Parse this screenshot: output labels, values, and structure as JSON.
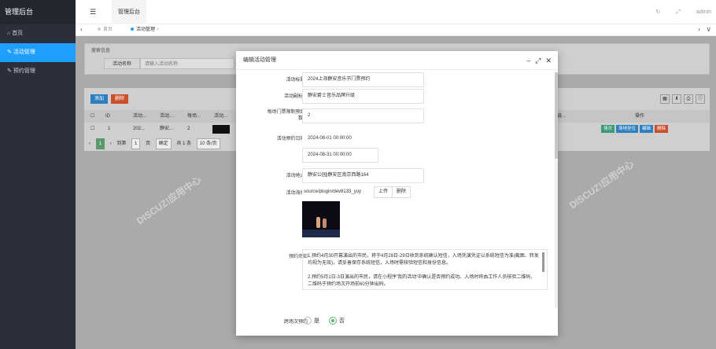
{
  "sidebar": {
    "brand": "管理后台",
    "items": [
      {
        "icon": "home-icon",
        "glyph": "⌂",
        "label": "首页"
      },
      {
        "icon": "edit-icon",
        "glyph": "✎",
        "label": "活动管理"
      },
      {
        "icon": "edit-icon",
        "glyph": "✎",
        "label": "预约管理"
      }
    ]
  },
  "topbar": {
    "title": "管理后台",
    "user": "admin"
  },
  "tabs": [
    {
      "label": "首页"
    },
    {
      "label": "活动管理"
    }
  ],
  "search": {
    "legend": "搜索信息",
    "label": "活动名称",
    "placeholder": "请输入活动名称"
  },
  "table": {
    "add_label": "添加",
    "delete_label": "删除",
    "headers": [
      "ID",
      "活动...",
      "活动...",
      "每场...",
      "活动...",
      "链...",
      "操作"
    ],
    "row": {
      "id": "1",
      "c1": "202...",
      "c2": "静安...",
      "c3": "2"
    },
    "row_actions": [
      "场次",
      "场地坐位",
      "编辑",
      "删除"
    ],
    "pager": {
      "to_label": "到第",
      "page": "1",
      "page_suffix": "页",
      "go_label": "确定",
      "total": "共 1 条",
      "per_page": "10 条/页"
    }
  },
  "modal": {
    "title": "编辑活动管理",
    "fields": {
      "title_label": "活动标题",
      "title_value": "2024上海静安音乐节门票预约",
      "subtitle_label": "活动副标题",
      "subtitle_value": "静安爵士音乐品牌升级",
      "limit_label_1": "每场门票限制预约",
      "limit_label_2": "数量",
      "limit_value": "2",
      "date_label": "活动预约日期",
      "date_start": "2024-08-01 00:00:00",
      "date_end": "2024-08-31 00:00:00",
      "place_label": "活动地点",
      "place_value": "静安公园|静安区南京西路164",
      "poster_label": "活动海报",
      "poster_value": "source/plugin/dev8133_yuy",
      "upload_label": "上传",
      "remove_label": "删除",
      "notice_label": "预约须知",
      "notice_p1": "1.预约4月30开幕演出的市民，将于4月28日-29日收到系统确认短信，入场凭演凭证以系统短信为准(截图、转发均视为无效)，请妥善保存系统短信，入场时需核验短信和身份信息。",
      "notice_p2": "2.预约5月1日-3日演出的市民，请在小程序'我的活动'中确认是否预约成功。入场时将由工作人员核验二维码，二维码于预约场次开场前60分钟出码。",
      "cross_label": "跨场次预约",
      "opt_yes": "是",
      "opt_no": "否"
    }
  },
  "colors": {
    "accent": "#1e9fff",
    "success": "#5FB878",
    "danger": "#e8501f",
    "sidebar": "#2a2f3a"
  }
}
